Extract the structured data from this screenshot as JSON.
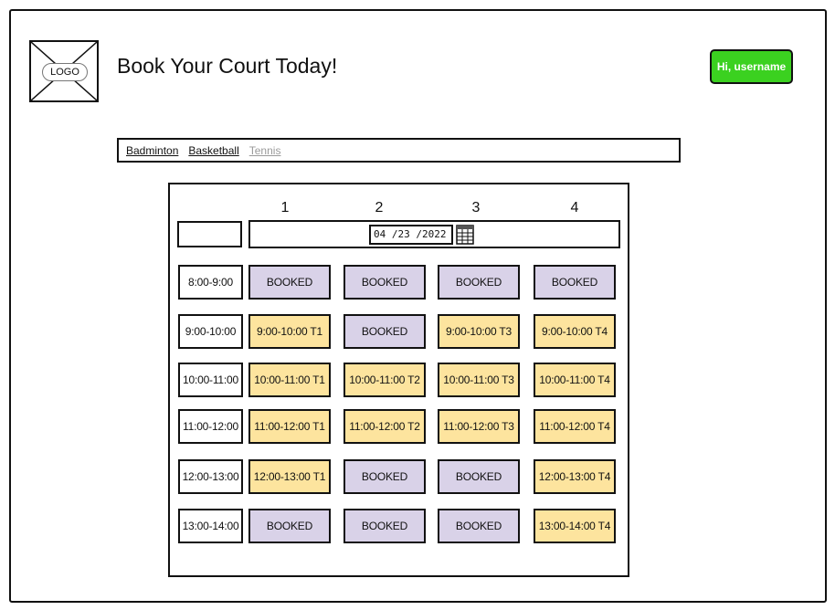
{
  "header": {
    "logo_label": "LOGO",
    "title": "Book Your Court Today!",
    "user_button": "Hi, username"
  },
  "tabs": [
    {
      "label": "Badminton",
      "active": true
    },
    {
      "label": "Basketball",
      "active": true
    },
    {
      "label": "Tennis",
      "active": false
    }
  ],
  "schedule": {
    "courts": [
      "1",
      "2",
      "3",
      "4"
    ],
    "date": "04 /23 /2022",
    "rows": [
      {
        "time": "8:00-9:00",
        "slots": [
          "BOOKED",
          "BOOKED",
          "BOOKED",
          "BOOKED"
        ]
      },
      {
        "time": "9:00-10:00",
        "slots": [
          "9:00-10:00 T1",
          "BOOKED",
          "9:00-10:00 T3",
          "9:00-10:00 T4"
        ]
      },
      {
        "time": "10:00-11:00",
        "slots": [
          "10:00-11:00 T1",
          "10:00-11:00 T2",
          "10:00-11:00 T3",
          "10:00-11:00 T4"
        ]
      },
      {
        "time": "11:00-12:00",
        "slots": [
          "11:00-12:00 T1",
          "11:00-12:00 T2",
          "11:00-12:00 T3",
          "11:00-12:00 T4"
        ]
      },
      {
        "time": "12:00-13:00",
        "slots": [
          "12:00-13:00 T1",
          "BOOKED",
          "BOOKED",
          "12:00-13:00 T4"
        ]
      },
      {
        "time": "13:00-14:00",
        "slots": [
          "BOOKED",
          "BOOKED",
          "BOOKED",
          "13:00-14:00 T4"
        ]
      }
    ]
  },
  "colors": {
    "booked": "#d9d2e8",
    "available": "#fde49e",
    "user_button": "#3bd120"
  },
  "icons": [
    "logo-placeholder-icon",
    "calendar-icon"
  ]
}
